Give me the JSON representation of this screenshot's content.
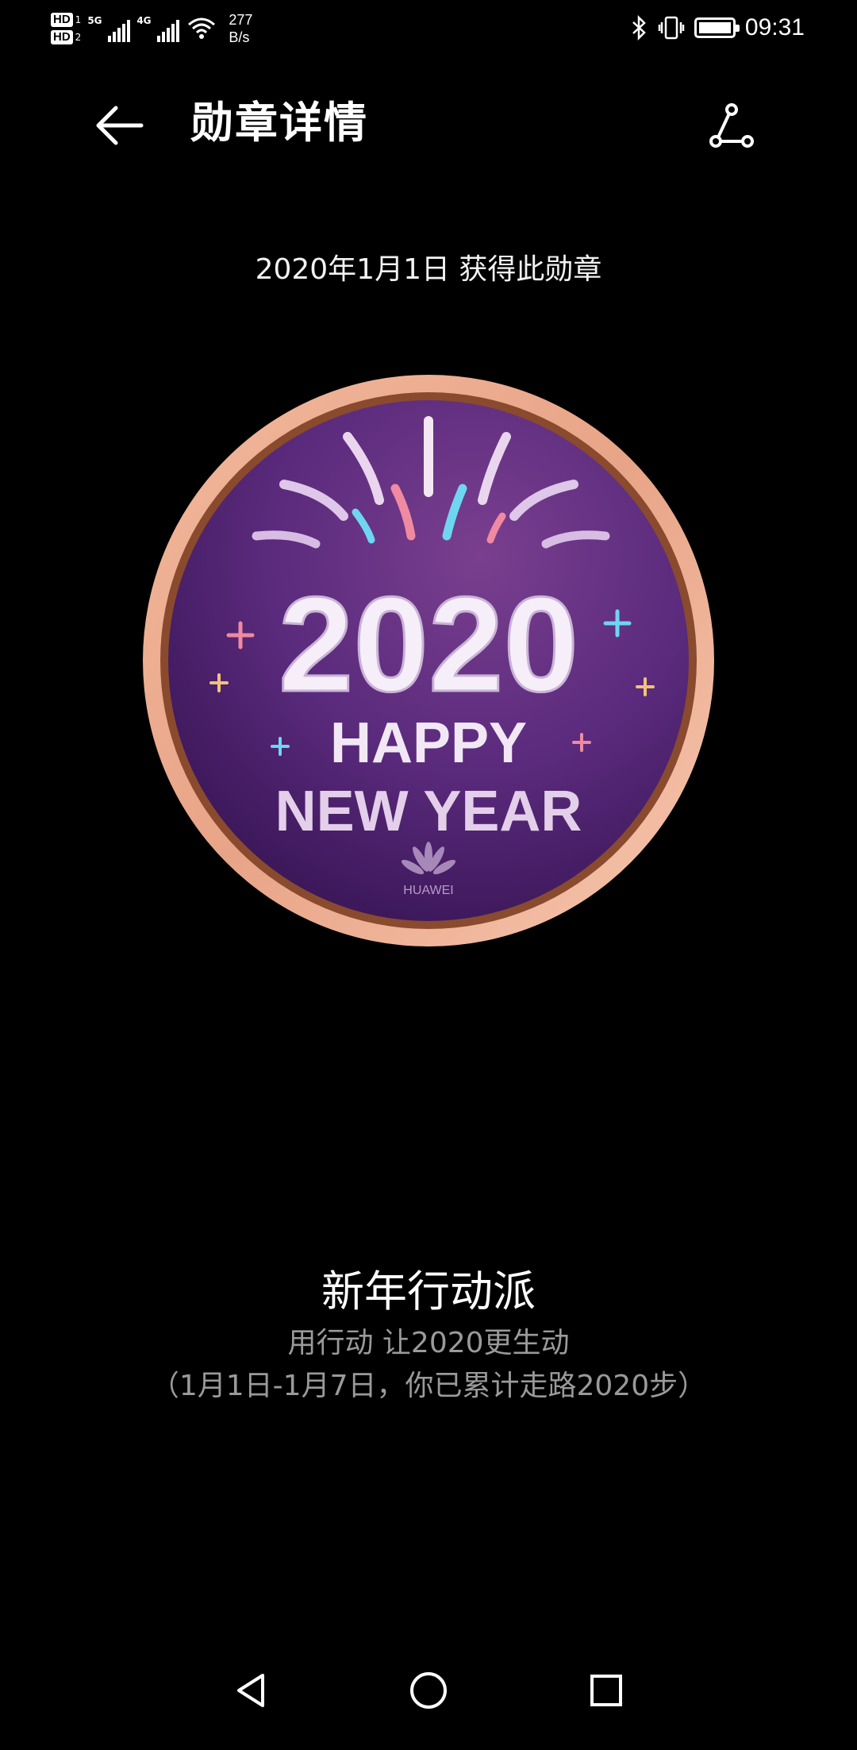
{
  "status_bar": {
    "hd1": "HD",
    "hd1_sub": "1",
    "hd2": "HD",
    "hd2_sub": "2",
    "sim1_tag": "5G",
    "sim2_tag": "4G",
    "net_speed_value": "277",
    "net_speed_unit": "B/s",
    "time": "09:31",
    "icons": [
      "bluetooth-icon",
      "vibrate-icon",
      "battery-icon"
    ]
  },
  "header": {
    "title": "勋章详情",
    "back_icon": "arrow-left-icon",
    "share_icon": "share-icon"
  },
  "earned_date": "2020年1月1日 获得此勋章",
  "badge": {
    "year": "2020",
    "line1": "HAPPY",
    "line2": "NEW YEAR",
    "brand": "HUAWEI",
    "colors": {
      "rim": "#e8a487",
      "rim_inner": "#8a4a2e",
      "face": "#4f2272",
      "face_highlight": "#7a3f8f"
    }
  },
  "medal_info": {
    "name": "新年行动派",
    "description": "用行动 让2020更生动",
    "progress": "（1月1日-1月7日，你已累计走路2020步）"
  },
  "nav": {
    "back_icon": "triangle-back-icon",
    "home_icon": "circle-home-icon",
    "recents_icon": "square-recents-icon"
  }
}
